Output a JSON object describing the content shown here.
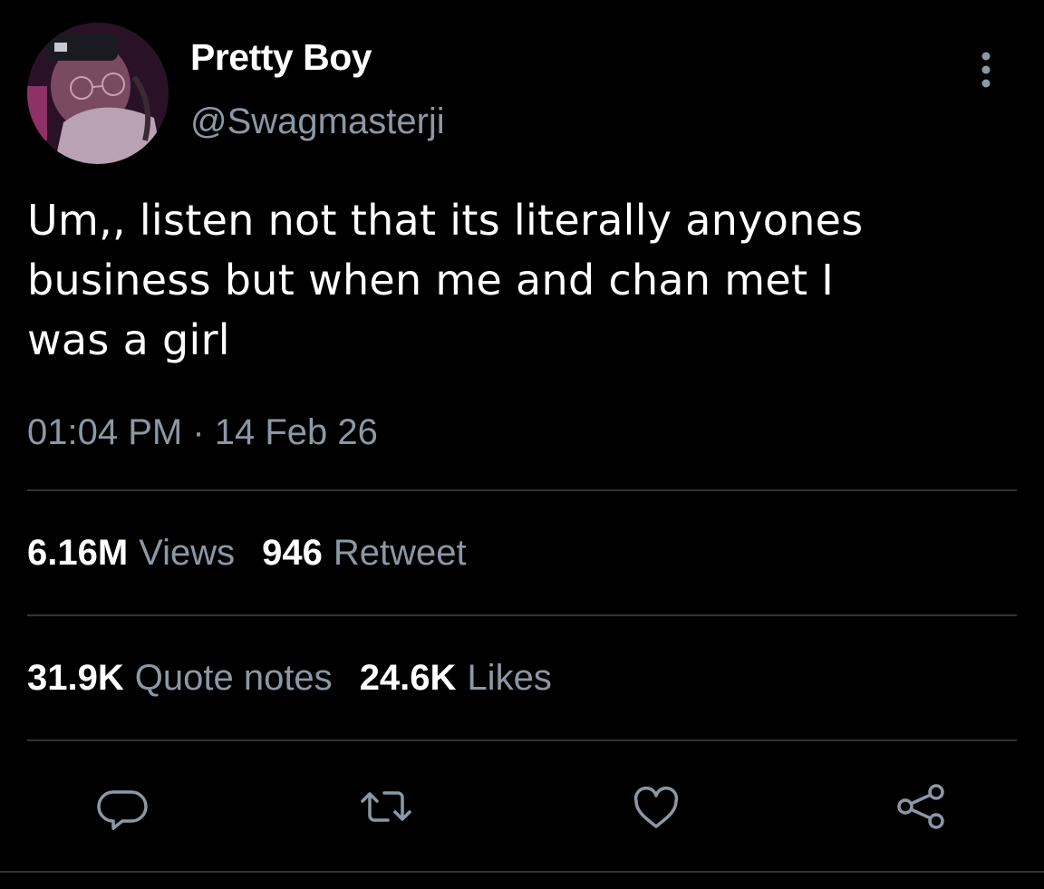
{
  "author": {
    "display_name": "Pretty Boy",
    "handle": "@Swagmasterji",
    "avatar_icon": "profile-photo"
  },
  "tweet": {
    "text": "Um,, listen not that its literally anyones\nbusiness but when me and chan met I\nwas a girl",
    "timestamp": "01:04 PM · 14 Feb 26"
  },
  "stats": {
    "views": {
      "count": "6.16M",
      "label": "Views"
    },
    "retweets": {
      "count": "946",
      "label": "Retweet"
    },
    "quotes": {
      "count": "31.9K",
      "label": "Quote notes"
    },
    "likes": {
      "count": "24.6K",
      "label": "Likes"
    }
  },
  "actions": {
    "reply_icon": "speech-bubble-icon",
    "retweet_icon": "retweet-arrows-icon",
    "like_icon": "heart-icon",
    "share_icon": "share-nodes-icon",
    "more_icon": "vertical-ellipsis-icon"
  },
  "colors": {
    "background": "#000000",
    "primary_text": "#ffffff",
    "secondary_text": "#8b98a5",
    "divider": "#2f3336",
    "icon": "#8b98a5"
  }
}
